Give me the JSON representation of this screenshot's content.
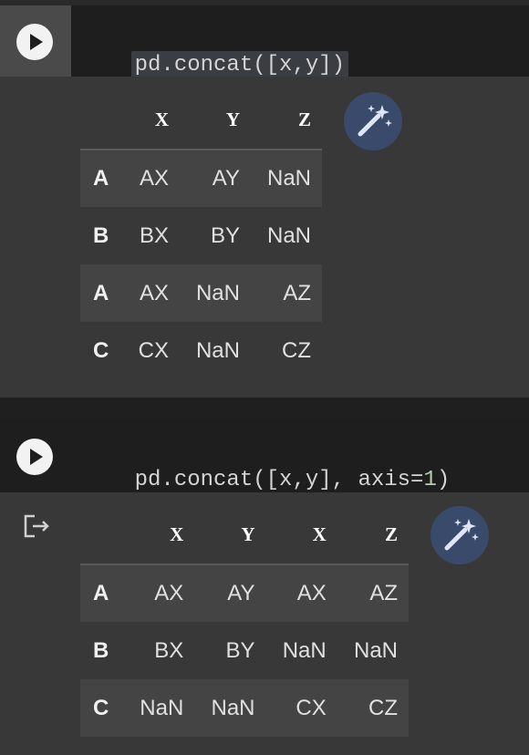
{
  "cells": [
    {
      "code_hl": "pd.concat([x,y])",
      "output": {
        "columns": [
          "X",
          "Y",
          "Z"
        ],
        "rows": [
          {
            "index": "A",
            "values": [
              "AX",
              "AY",
              "NaN"
            ]
          },
          {
            "index": "B",
            "values": [
              "BX",
              "BY",
              "NaN"
            ]
          },
          {
            "index": "A",
            "values": [
              "AX",
              "NaN",
              "AZ"
            ]
          },
          {
            "index": "C",
            "values": [
              "CX",
              "NaN",
              "CZ"
            ]
          }
        ]
      }
    },
    {
      "code_prefix": "pd.concat([x,y], axis=",
      "code_num": "1",
      "code_suffix": ")",
      "output": {
        "columns": [
          "X",
          "Y",
          "X",
          "Z"
        ],
        "rows": [
          {
            "index": "A",
            "values": [
              "AX",
              "AY",
              "AX",
              "AZ"
            ]
          },
          {
            "index": "B",
            "values": [
              "BX",
              "BY",
              "NaN",
              "NaN"
            ]
          },
          {
            "index": "C",
            "values": [
              "NaN",
              "NaN",
              "CX",
              "CZ"
            ]
          }
        ]
      }
    }
  ],
  "icons": {
    "run": "play-icon",
    "magic": "magic-wand-icon",
    "output_action": "output-redirect-icon"
  },
  "colors": {
    "background": "#212121",
    "output_bg": "#383838",
    "stripe": "#444444",
    "magic_button": "#3a4a6b",
    "number_literal": "#b5cea8"
  }
}
